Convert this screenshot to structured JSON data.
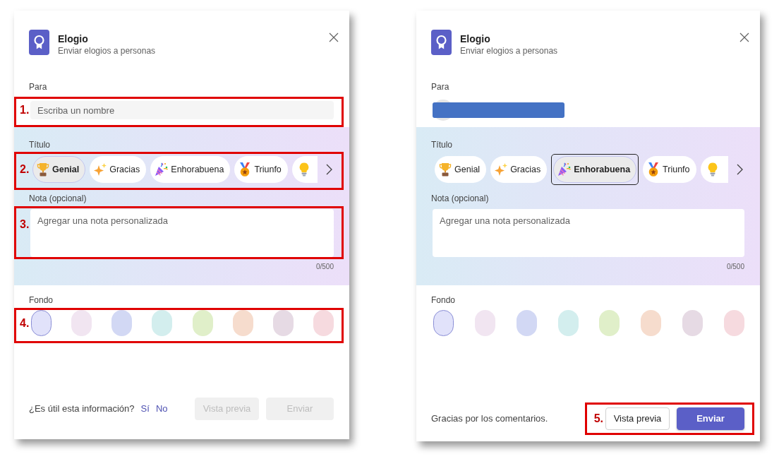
{
  "panels": [
    {
      "header": {
        "title": "Elogio",
        "subtitle": "Enviar elogios a personas"
      },
      "to": {
        "label": "Para",
        "kind": "input",
        "placeholder": "Escriba un nombre",
        "annotation": "1."
      },
      "title_picker": {
        "label": "Título",
        "annotation": "2.",
        "options": [
          {
            "label": "Genial",
            "selected": true,
            "focused": false
          },
          {
            "label": "Gracias",
            "selected": false,
            "focused": false
          },
          {
            "label": "Enhorabuena",
            "selected": false,
            "focused": false
          },
          {
            "label": "Triunfo",
            "selected": false,
            "focused": false
          },
          {
            "selected": false,
            "focused": false
          }
        ]
      },
      "note": {
        "label": "Nota (opcional)",
        "placeholder": "Agregar una nota personalizada",
        "counter": "0/500",
        "annotation": "3."
      },
      "background": {
        "label": "Fondo",
        "annotation": "4.",
        "swatches": [
          {
            "color": "#e1e2fa",
            "selected": true
          },
          {
            "color": "#f1e5f1",
            "selected": false
          },
          {
            "color": "#d2d8f4",
            "selected": false
          },
          {
            "color": "#d3eeee",
            "selected": false
          },
          {
            "color": "#e0efc9",
            "selected": false
          },
          {
            "color": "#f6dccd",
            "selected": false
          },
          {
            "color": "#e6dae4",
            "selected": false
          },
          {
            "color": "#f6dadf",
            "selected": false
          }
        ]
      },
      "footer": {
        "feedback": {
          "kind": "question",
          "text": "¿Es útil esta información?",
          "links": [
            "Sí",
            "No"
          ]
        },
        "buttons": [
          {
            "label": "Vista previa",
            "kind": "secondary",
            "disabled": true
          },
          {
            "label": "Enviar",
            "kind": "primary",
            "disabled": true
          }
        ]
      }
    },
    {
      "header": {
        "title": "Elogio",
        "subtitle": "Enviar elogios a personas"
      },
      "to": {
        "label": "Para",
        "kind": "redacted"
      },
      "title_picker": {
        "label": "Título",
        "options": [
          {
            "label": "Genial",
            "selected": false,
            "focused": false
          },
          {
            "label": "Gracias",
            "selected": false,
            "focused": false
          },
          {
            "label": "Enhorabuena",
            "selected": true,
            "focused": true
          },
          {
            "label": "Triunfo",
            "selected": false,
            "focused": false
          },
          {
            "selected": false,
            "focused": false
          }
        ]
      },
      "note": {
        "label": "Nota (opcional)",
        "placeholder": "Agregar una nota personalizada",
        "counter": "0/500"
      },
      "background": {
        "label": "Fondo",
        "swatches": [
          {
            "color": "#e1e2fa",
            "selected": true
          },
          {
            "color": "#f1e5f1",
            "selected": false
          },
          {
            "color": "#d2d8f4",
            "selected": false
          },
          {
            "color": "#d3eeee",
            "selected": false
          },
          {
            "color": "#e0efc9",
            "selected": false
          },
          {
            "color": "#f6dccd",
            "selected": false
          },
          {
            "color": "#e6dae4",
            "selected": false
          },
          {
            "color": "#f6dadf",
            "selected": false
          }
        ]
      },
      "footer": {
        "annotation": "5.",
        "feedback": {
          "kind": "thanks",
          "text": "Gracias por los comentarios."
        },
        "buttons": [
          {
            "label": "Vista previa",
            "kind": "secondary",
            "disabled": false
          },
          {
            "label": "Enviar",
            "kind": "primary",
            "disabled": false
          }
        ]
      }
    }
  ]
}
